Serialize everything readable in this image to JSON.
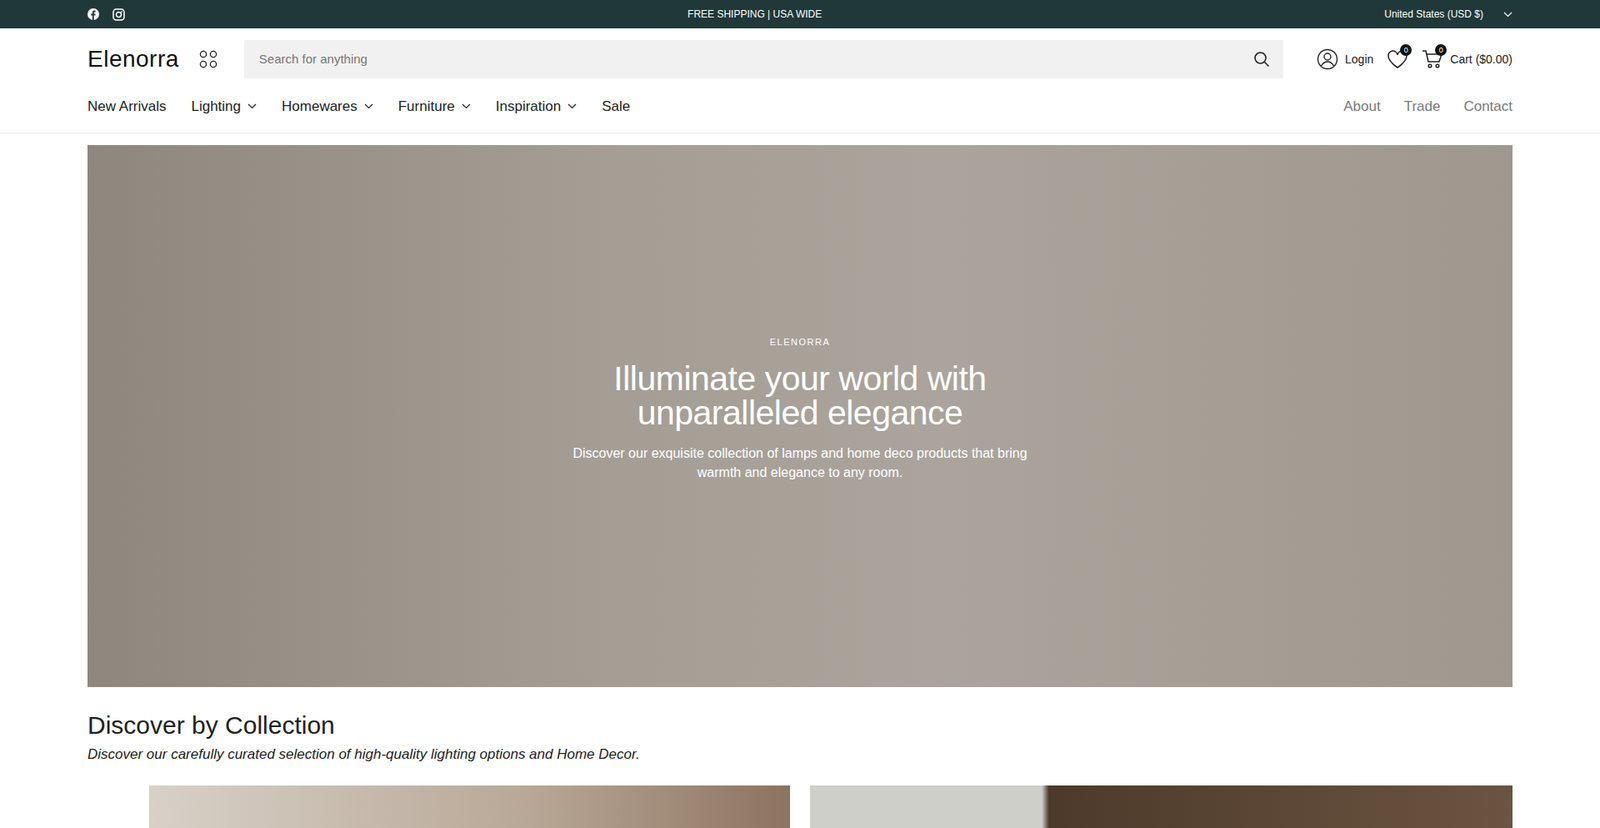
{
  "topbar": {
    "announcement": "FREE SHIPPING | USA WIDE",
    "region": "United States (USD $)"
  },
  "header": {
    "logo": "Elenorra",
    "search": {
      "placeholder": "Search for anything"
    },
    "login": "Login",
    "wishlist_count": "0",
    "cart_count": "0",
    "cart_label": "Cart ($0.00)"
  },
  "nav": {
    "items": [
      {
        "label": "New Arrivals",
        "kind": "link"
      },
      {
        "label": "Lighting",
        "kind": "dropdown"
      },
      {
        "label": "Homewares",
        "kind": "dropdown"
      },
      {
        "label": "Furniture",
        "kind": "dropdown"
      },
      {
        "label": "Inspiration",
        "kind": "dropdown"
      },
      {
        "label": "Sale",
        "kind": "link"
      }
    ],
    "secondary": [
      "About",
      "Trade",
      "Contact"
    ]
  },
  "hero": {
    "eyebrow": "ELENORRA",
    "title": "Illuminate your world with unparalleled elegance",
    "text": "Discover our exquisite collection of lamps and home deco products that bring warmth and elegance to any room."
  },
  "collection": {
    "title": "Discover by Collection",
    "subtitle": "Discover our carefully curated selection of high-quality lighting options and Home Decor."
  }
}
